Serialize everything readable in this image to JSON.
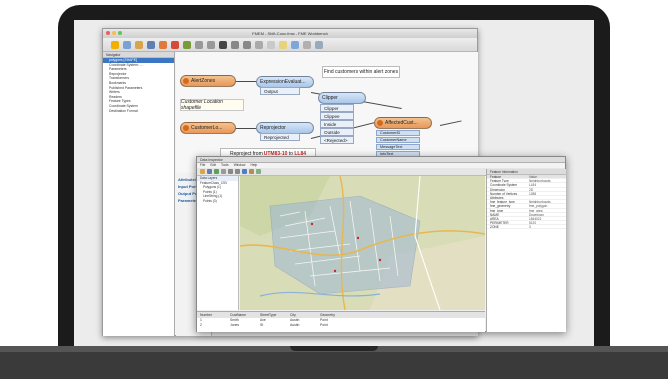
{
  "workbench": {
    "title": "FMEM - Shift-Conc.fmw - FME Workbench",
    "navigator_header": "Navigator",
    "nav_items": [
      "polygons [SHAPE]",
      "Coordinate System: ...",
      "Parameters",
      "Reprojector",
      "Transformers",
      "Bookmarks",
      "Published Parameters",
      "Writers",
      "Readers",
      "Feature Types",
      "Coordinate System",
      "Destination Format"
    ],
    "nodes": {
      "alert_zones": "AlertZones",
      "expression": "ExpressionEvaluat...",
      "output_port": "Output",
      "customer": "CustomerLo...",
      "reprojector": "Reprojector",
      "reprojected_port": "Reprojected",
      "clipper": "Clipper",
      "clipper_port": "Clipper",
      "clippee_port": "Clippee",
      "inside_port": "Inside",
      "outside_port": "Outside",
      "rejected_port": "<Rejected>",
      "affected": "AffectedCust...",
      "attrs": [
        "CustomerID",
        "CustomerName",
        "MessageText",
        "InfoText"
      ]
    },
    "note_find": "Find customers within alert zones",
    "note_customer": "Customer Location shapefile",
    "note_reproject": {
      "prefix": "Reproject from ",
      "from": "UTM83-10",
      "mid": " to ",
      "to": "LL84"
    },
    "inspector_title": "AttributeCreator",
    "inspector_sections": [
      "Input Ports",
      "Output Ports",
      "Parameters"
    ]
  },
  "inspector": {
    "title": "Data Inspector",
    "menu": [
      "File",
      "Edit",
      "Tools",
      "Window",
      "Help"
    ],
    "tree_items": [
      "Data Layers",
      "FeatureClass_CSV",
      "Polygons (1)",
      "Points (1)",
      "LineString (1)",
      "Points (3)"
    ],
    "props_header": "Feature Information",
    "props": [
      [
        "Feature",
        "Value"
      ],
      [
        "Feature Type",
        "Neighborhoods"
      ],
      [
        "Coordinate System",
        "LL84"
      ],
      [
        "Dimension",
        "2D"
      ],
      [
        "Number of Vertices",
        "1288"
      ],
      [
        "Attributes",
        ""
      ],
      [
        "fme_feature_type",
        "Neighborhoods"
      ],
      [
        "fme_geometry",
        "fme_polygon"
      ],
      [
        "fme_type",
        "fme_area"
      ],
      [
        "NAME",
        "Downtown"
      ],
      [
        "AREA",
        "1844021"
      ],
      [
        "PERIMETER",
        "5120"
      ],
      [
        "ZONE",
        "3"
      ]
    ],
    "table_headers": [
      "Number",
      "CustName",
      "StreetType",
      "City",
      "Geometry"
    ],
    "table_rows": [
      [
        "1",
        "Smith",
        "Ave",
        "Austin",
        "Point"
      ],
      [
        "2",
        "Jones",
        "St",
        "Austin",
        "Point"
      ]
    ]
  },
  "colors": {
    "accent": "#3b76c4",
    "node_orange": "#e9985a",
    "node_blue": "#a9c6ea",
    "note_red": "#c62828"
  }
}
